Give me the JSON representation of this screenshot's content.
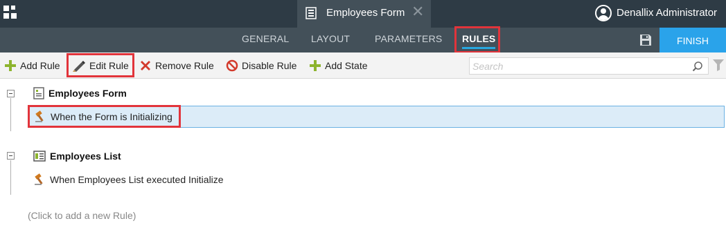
{
  "header": {
    "doc_tab_title": "Employees Form",
    "user_name": "Denallix Administrator"
  },
  "nav": {
    "tabs": [
      "GENERAL",
      "LAYOUT",
      "PARAMETERS",
      "RULES"
    ],
    "active_tab": "RULES",
    "finish_label": "FINISH"
  },
  "toolbar": {
    "add_rule": "Add Rule",
    "edit_rule": "Edit Rule",
    "remove_rule": "Remove Rule",
    "disable_rule": "Disable Rule",
    "add_state": "Add State",
    "search_placeholder": "Search"
  },
  "rules": {
    "groups": [
      {
        "title": "Employees Form",
        "icon": "form-icon",
        "rules": [
          "When the Form is Initializing"
        ]
      },
      {
        "title": "Employees List",
        "icon": "list-view-icon",
        "rules": [
          "When Employees List executed Initialize"
        ]
      }
    ],
    "add_hint": "(Click to add a new Rule)"
  },
  "colors": {
    "topbar": "#2e3b45",
    "navbar": "#435059",
    "accent_blue": "#2aa3ea",
    "highlight_red": "#e2343b",
    "selected_row": "#dcecf8"
  }
}
